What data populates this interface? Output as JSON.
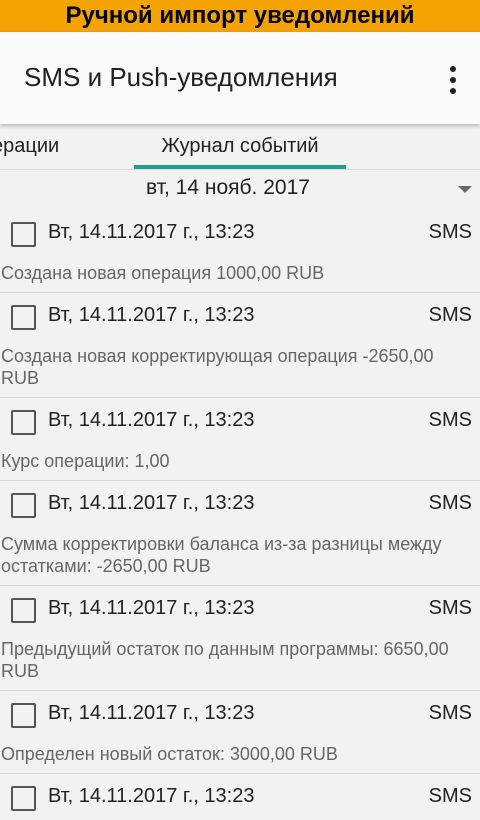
{
  "banner": {
    "text": "Ручной импорт уведомлений"
  },
  "appbar": {
    "title": "SMS и Push-уведомления",
    "menu_icon": "more-vert-icon"
  },
  "tabs": [
    {
      "label": "ерации",
      "active": false
    },
    {
      "label": "Журнал событий",
      "active": true
    }
  ],
  "date_filter": {
    "value": "вт, 14 нояб. 2017",
    "icon": "dropdown-arrow-icon"
  },
  "entries": [
    {
      "date": "Вт, 14.11.2017 г., 13:23",
      "type": "SMS",
      "message": "Создана новая операция 1000,00 RUB"
    },
    {
      "date": "Вт, 14.11.2017 г., 13:23",
      "type": "SMS",
      "message": "Создана новая корректирующая операция -2650,00 RUB"
    },
    {
      "date": "Вт, 14.11.2017 г., 13:23",
      "type": "SMS",
      "message": "Курс операции: 1,00"
    },
    {
      "date": "Вт, 14.11.2017 г., 13:23",
      "type": "SMS",
      "message": "Сумма корректировки баланса из-за разницы между остатками: -2650,00 RUB"
    },
    {
      "date": "Вт, 14.11.2017 г., 13:23",
      "type": "SMS",
      "message": "Предыдущий остаток по данным программы: 6650,00 RUB"
    },
    {
      "date": "Вт, 14.11.2017 г., 13:23",
      "type": "SMS",
      "message": "Определен новый остаток: 3000,00 RUB"
    },
    {
      "date": "Вт, 14.11.2017 г., 13:23",
      "type": "SMS",
      "message": ""
    }
  ],
  "colors": {
    "banner": "#f5a300",
    "tab_indicator": "#1f9f91"
  }
}
